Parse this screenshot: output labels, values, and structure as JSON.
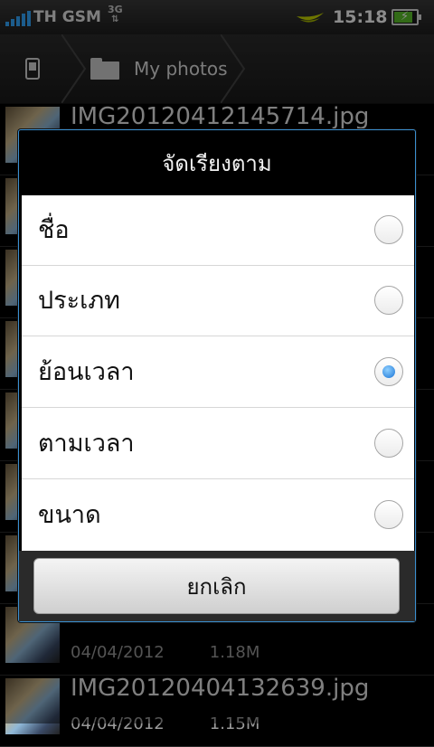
{
  "status_bar": {
    "carrier": "TH GSM",
    "network_type": "3G",
    "time": "15:18",
    "battery_level": 0.85,
    "icons": [
      "signal-icon",
      "network-3g-icon",
      "operator-logo-icon",
      "battery-charging-icon"
    ]
  },
  "breadcrumb": {
    "home_icon": "phone-icon",
    "folder_icon": "folder-icon",
    "current": "My photos"
  },
  "files": [
    {
      "name": "IMG20120412145714.jpg",
      "date": "",
      "size": ""
    },
    {
      "name": "",
      "date": "",
      "size": ""
    },
    {
      "name": "",
      "date": "",
      "size": ""
    },
    {
      "name": "",
      "date": "",
      "size": ""
    },
    {
      "name": "",
      "date": "",
      "size": ""
    },
    {
      "name": "",
      "date": "",
      "size": ""
    },
    {
      "name": "",
      "date": "",
      "size": ""
    },
    {
      "name": "",
      "date": "04/04/2012",
      "size": "1.18M"
    },
    {
      "name": "IMG20120404132639.jpg",
      "date": "04/04/2012",
      "size": "1.15M"
    }
  ],
  "dialog": {
    "title": "จัดเรียงตาม",
    "options": [
      {
        "label": "ชื่อ",
        "selected": false
      },
      {
        "label": "ประเภท",
        "selected": false
      },
      {
        "label": "ย้อนเวลา",
        "selected": true
      },
      {
        "label": "ตามเวลา",
        "selected": false
      },
      {
        "label": "ขนาด",
        "selected": false
      }
    ],
    "cancel_label": "ยกเลิก"
  },
  "colors": {
    "accent": "#3a8fd0",
    "signal": "#34a8ff",
    "battery": "#5cc22a"
  }
}
